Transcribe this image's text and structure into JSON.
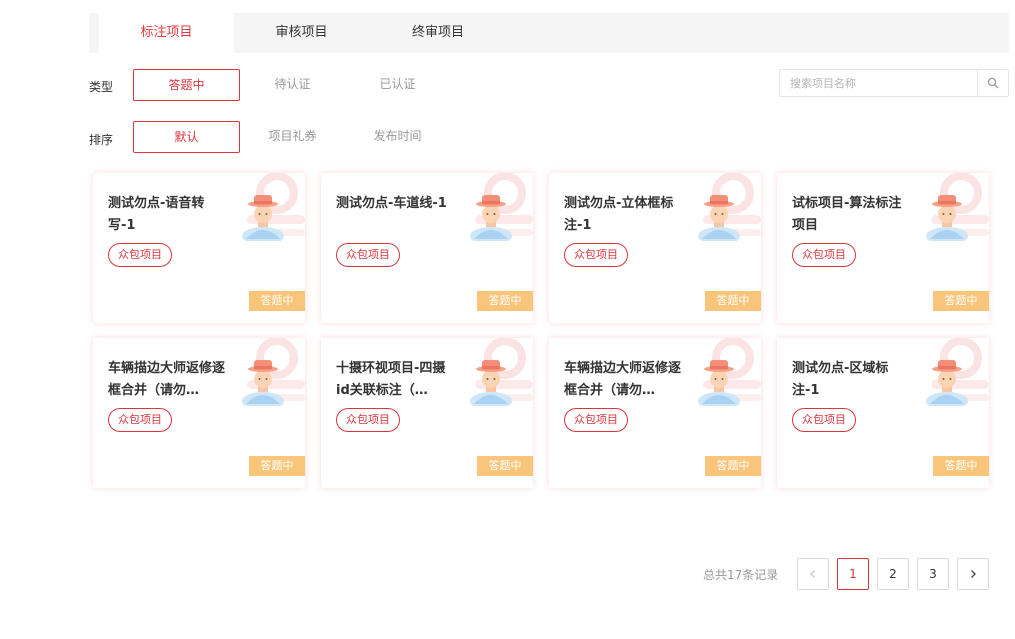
{
  "tabs": [
    {
      "label": "标注项目",
      "active": true
    },
    {
      "label": "审核项目",
      "active": false
    },
    {
      "label": "终审项目",
      "active": false
    }
  ],
  "filters": {
    "type_label": "类型",
    "type_options": [
      "答题中",
      "待认证",
      "已认证"
    ],
    "sort_label": "排序",
    "sort_options": [
      "默认",
      "项目礼券",
      "发布时间"
    ]
  },
  "search": {
    "placeholder": "搜索项目名称",
    "value": "",
    "icon": "search-icon"
  },
  "cards": [
    {
      "title": "测试勿点-语音转写-1",
      "tag": "众包项目",
      "status": "答题中"
    },
    {
      "title": "测试勿点-车道线-1",
      "tag": "众包项目",
      "status": "答题中"
    },
    {
      "title": "测试勿点-立体框标注-1",
      "tag": "众包项目",
      "status": "答题中"
    },
    {
      "title": "试标项目-算法标注项目",
      "tag": "众包项目",
      "status": "答题中"
    },
    {
      "title": "车辆描边大师返修逐框合并（请勿…",
      "tag": "众包项目",
      "status": "答题中"
    },
    {
      "title": "十摄环视项目-四摄id关联标注（…",
      "tag": "众包项目",
      "status": "答题中"
    },
    {
      "title": "车辆描边大师返修逐框合并（请勿…",
      "tag": "众包项目",
      "status": "答题中"
    },
    {
      "title": "测试勿点-区域标注-1",
      "tag": "众包项目",
      "status": "答题中"
    }
  ],
  "pagination": {
    "total_text": "总共17条记录",
    "pages": [
      "1",
      "2",
      "3"
    ],
    "current": "1",
    "prev_icon": "chevron-left-icon",
    "next_icon": "chevron-right-icon"
  },
  "colors": {
    "accent": "#d9363e",
    "status_bg": "#f9c57a",
    "tab_bg": "#f5f5f5"
  }
}
